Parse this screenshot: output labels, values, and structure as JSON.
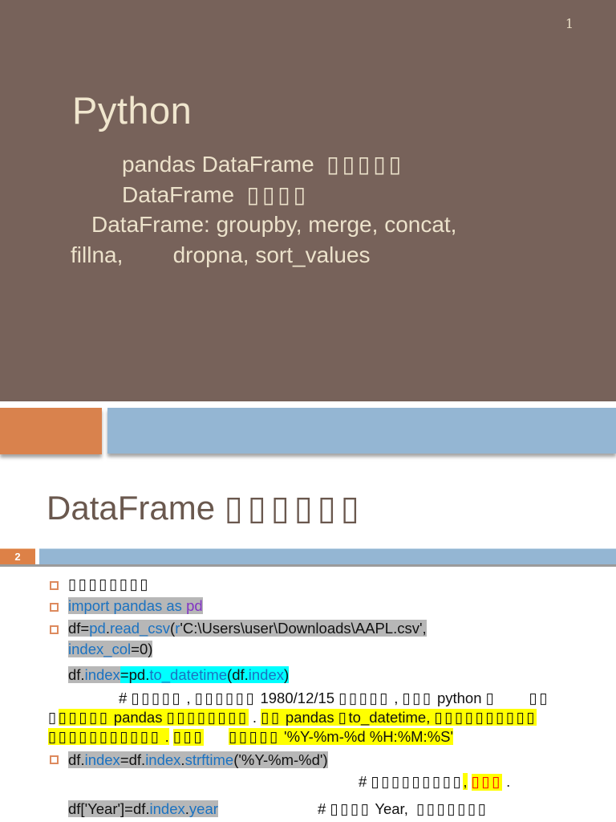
{
  "colors": {
    "slide_bg": "#77625a",
    "accent_orange": "#d9824d",
    "accent_blue": "#94b6d3",
    "code_highlight_gray": "#b7b7b7",
    "highlight_cyan": "#00ffff",
    "highlight_yellow": "#ffff00",
    "code_blue": "#1b72c1",
    "code_purple": "#8233c4",
    "red": "#ff0000",
    "title2_color": "#6a584e"
  },
  "slide1": {
    "page_number": "1",
    "title": "Python",
    "sub1_text": "pandas DataFrame  ",
    "sub1_tofu": "▯▯▯▯▯",
    "sub2_text": "DataFrame  ",
    "sub2_tofu": "▯▯▯▯",
    "sub3": "DataFrame: groupby, merge, concat,",
    "sub4": "fillna,        dropna, sort_values"
  },
  "slide2": {
    "page_number": "2",
    "title_text": "DataFrame ",
    "title_tofu": "▯▯▯▯▯▯",
    "l1": {
      "tofu": "▯▯▯▯▯▯▯▯"
    },
    "l2": {
      "import": "import pandas as ",
      "pd": "pd"
    },
    "l3a": {
      "s1": "df=",
      "s2": "pd",
      "s3": ".",
      "s4": "read_csv",
      "s5": "(",
      "s6": "r",
      "s7": "'C:\\Users\\user\\Downloads\\AAPL.csv',"
    },
    "l3b": {
      "s1": "index_col",
      "s2": "=0)"
    },
    "l4": {
      "g1": "df.",
      "g2": "index",
      "c1": "=pd.",
      "c2": "to_datetime",
      "c3": "(df.",
      "c4": "index",
      "c5": ")"
    },
    "l5": {
      "s1": "# ",
      "s2": "▯▯▯▯▯",
      "s3": " , ",
      "s4": "▯▯▯▯▯▯",
      "s5": " 1980/12/15 ",
      "s6": "▯▯▯▯▯",
      "s7": " , ",
      "s8": "▯▯▯",
      "s9": " python ",
      "s10": "▯",
      "s11": "        ",
      "s12": "▯▯"
    },
    "l6": {
      "s1": "▯",
      "s2a": "▯▯▯▯▯",
      "s2b": " pandas ",
      "s2c": "▯▯▯▯▯▯▯▯",
      "s3": " . ",
      "s4a": "▯▯",
      "s4b": " pandas ",
      "s4c": "▯",
      "s4d": "to_datetime, ",
      "s4e": "▯▯▯▯▯▯▯▯▯▯"
    },
    "l7": {
      "s1a": "▯▯▯▯▯▯▯▯▯▯▯",
      "s1b": " .",
      "s2": " ",
      "s3": "▯▯▯",
      "s4": "      ",
      "s5a": "▯▯▯▯▯",
      "s5b": " '%Y-%m-%d %H:%M:%S'"
    },
    "l8": {
      "s1": "df",
      "s2": ".",
      "s3": "index",
      "s4": "=df",
      "s5": ".",
      "s6": "index",
      "s7": ".",
      "s8": "strftime",
      "s9": "('%Y-%m-%d')"
    },
    "l9": {
      "s1": "# ",
      "s2": "▯▯▯▯▯▯▯▯▯",
      "s3": ",",
      "s4": " ",
      "s5": "▯▯▯",
      "s6": " ."
    },
    "l10": {
      "c1": "df['Year']=df",
      "c2": ".",
      "c3": "index",
      "c4": ".",
      "c5": "year",
      "m1": "# ",
      "m2": "▯▯▯▯",
      "m3": " Year,  ",
      "m4": "▯▯▯▯▯▯▯"
    }
  }
}
